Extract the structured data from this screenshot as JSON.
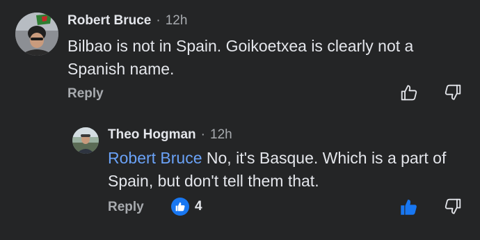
{
  "comments": [
    {
      "author": "Robert Bruce",
      "separator": "·",
      "time": "12h",
      "text": "Bilbao is not in Spain. Goikoetxea is clearly not a Spanish name.",
      "reply_label": "Reply",
      "like_state": "outline",
      "icons": {
        "like": "thumbs-up-outline-icon",
        "dislike": "thumbs-down-outline-icon"
      }
    },
    {
      "author": "Theo Hogman",
      "separator": "·",
      "time": "12h",
      "mention": "Robert Bruce",
      "text": " No, it's Basque. Which is a part of Spain, but don't tell them that.",
      "reply_label": "Reply",
      "reaction_count": "4",
      "like_state": "filled",
      "icons": {
        "reaction": "like-reaction-icon",
        "like": "thumbs-up-filled-icon",
        "dislike": "thumbs-down-outline-icon"
      }
    }
  ],
  "colors": {
    "background": "#242526",
    "text": "#e4e6eb",
    "muted": "#a8abaf",
    "mention": "#6aa2f7",
    "accent": "#1877f2"
  }
}
